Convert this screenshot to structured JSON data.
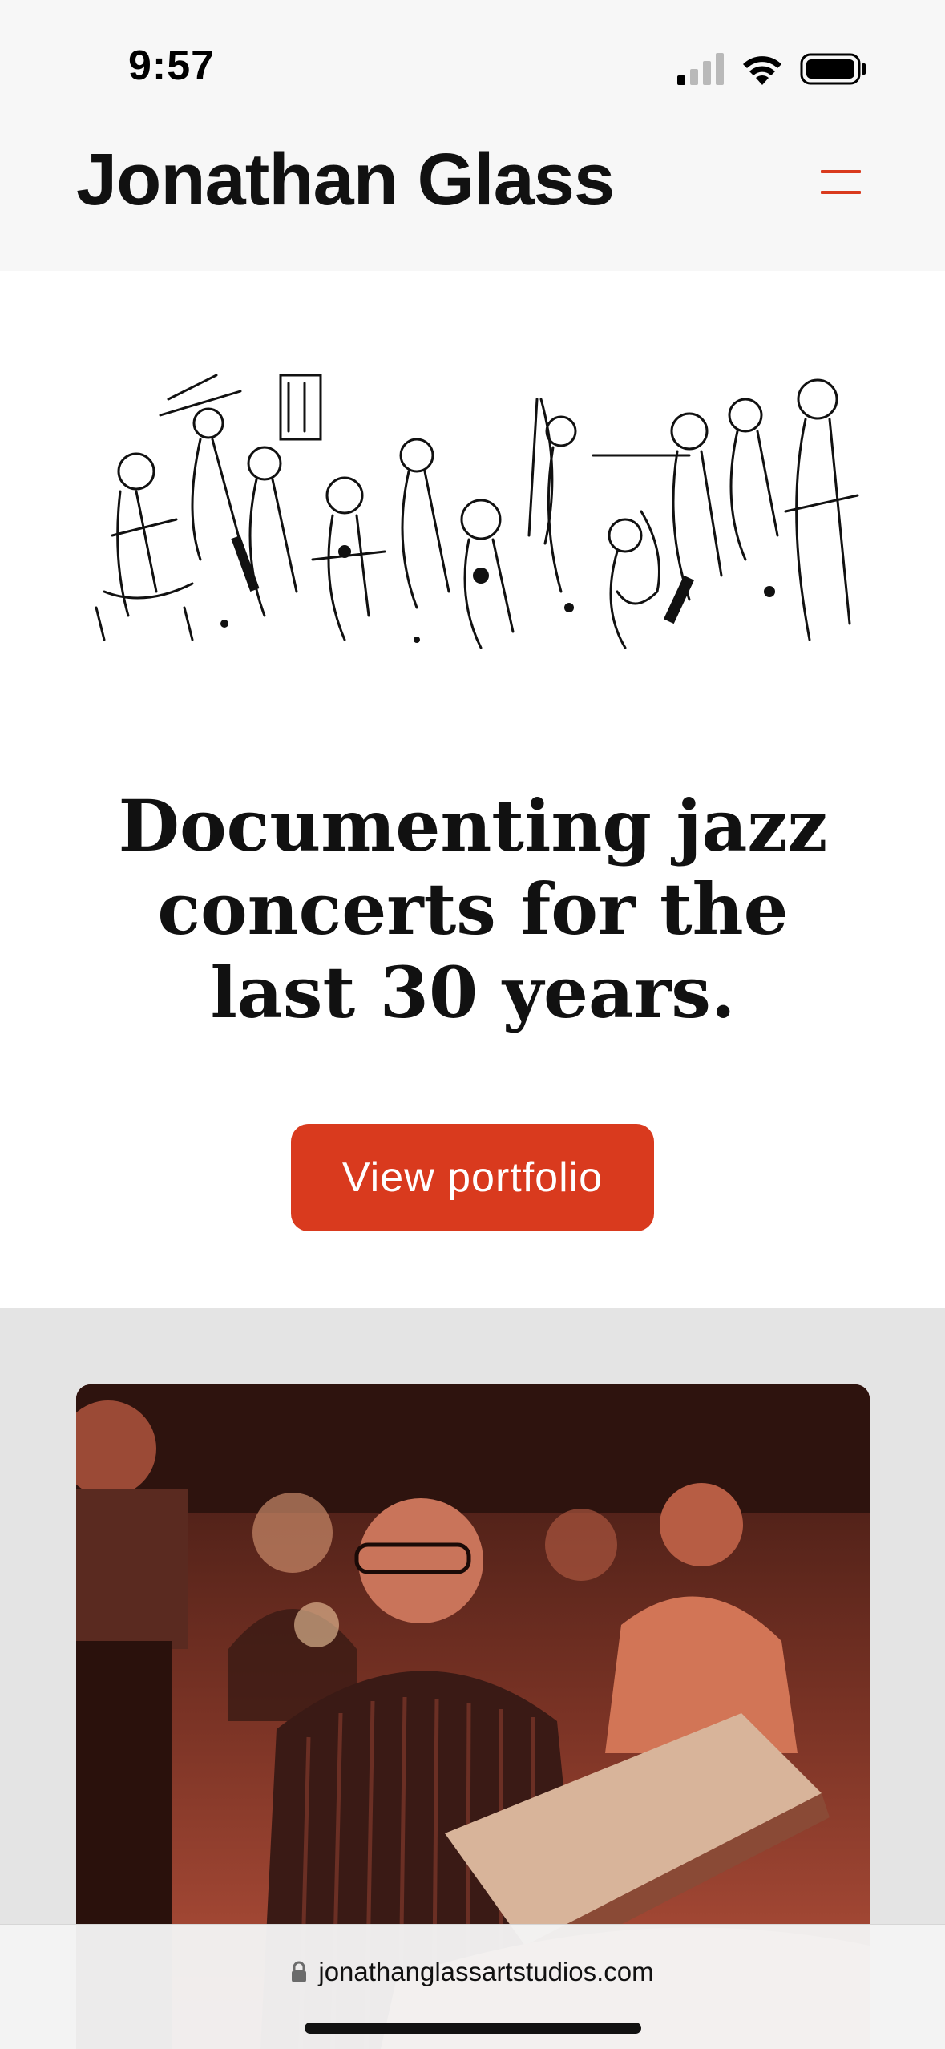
{
  "status_bar": {
    "time": "9:57",
    "icons": [
      "cellular-signal-icon",
      "wifi-icon",
      "battery-icon"
    ]
  },
  "header": {
    "title": "Jonathan Glass",
    "menu_icon": "hamburger-menu-icon"
  },
  "hero": {
    "image": "jazz-musicians-ink-sketch",
    "headline": "Documenting jazz concerts for the last 30 years.",
    "cta_label": "View portfolio"
  },
  "photo_section": {
    "image": "artist-sketching-at-jazz-club-photo"
  },
  "browser": {
    "url": "jonathanglassartstudios.com",
    "lock_icon": "lock-icon"
  },
  "colors": {
    "accent": "#d93a1e",
    "header_bg": "#f7f7f7",
    "section_bg": "#e4e4e4",
    "text": "#111111"
  }
}
